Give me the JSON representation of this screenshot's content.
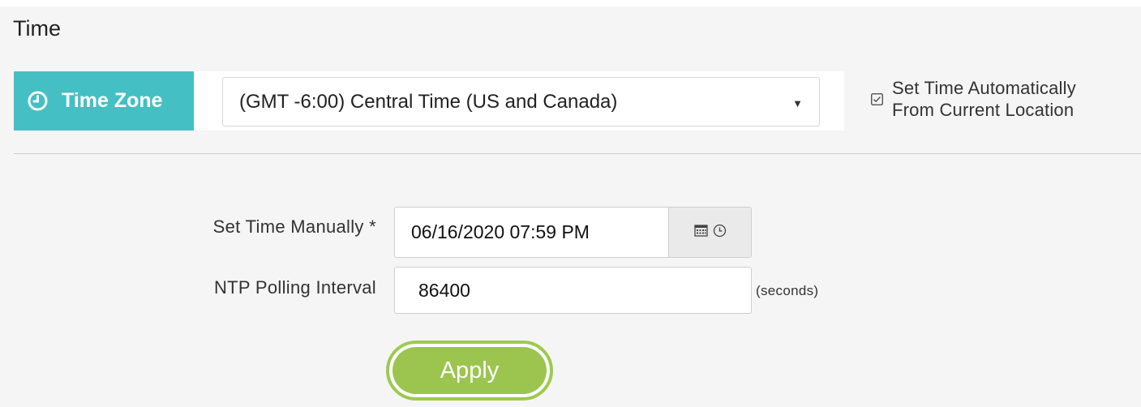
{
  "section": {
    "title": "Time"
  },
  "timezone": {
    "label": "Time Zone",
    "icon": "clock-icon",
    "selected": "(GMT -6:00) Central Time (US and Canada)",
    "accent_color": "#44bfc4"
  },
  "auto_set": {
    "line1": "Set Time Automatically",
    "line2": "From Current Location",
    "checked": false
  },
  "manual_time": {
    "label": "Set Time Manually *",
    "value": "06/16/2020 07:59 PM",
    "icons": [
      "calendar-icon",
      "clock-icon"
    ]
  },
  "ntp": {
    "label": "NTP Polling Interval",
    "value": "86400",
    "unit": "(seconds)"
  },
  "apply": {
    "label": "Apply",
    "color": "#9cc550"
  }
}
